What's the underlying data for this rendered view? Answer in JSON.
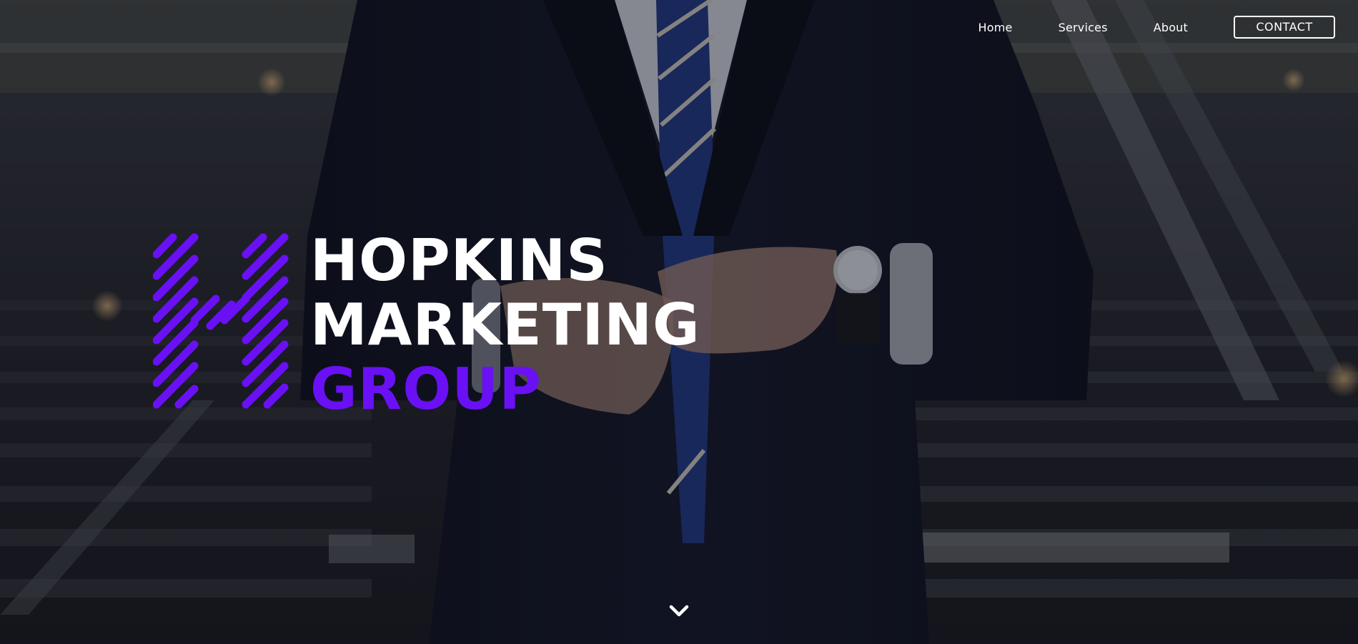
{
  "nav": {
    "items": [
      {
        "label": "Home"
      },
      {
        "label": "Services"
      },
      {
        "label": "About"
      }
    ],
    "contact_label": "CONTACT"
  },
  "brand": {
    "line1": "HOPKINS",
    "line2": "MARKETING",
    "line3": "GROUP",
    "accent_color": "#6a10f5",
    "logo_icon": "h-logo-icon"
  },
  "scroll": {
    "icon": "chevron-down-icon"
  },
  "colors": {
    "text": "#ffffff",
    "accent": "#6a10f5"
  }
}
